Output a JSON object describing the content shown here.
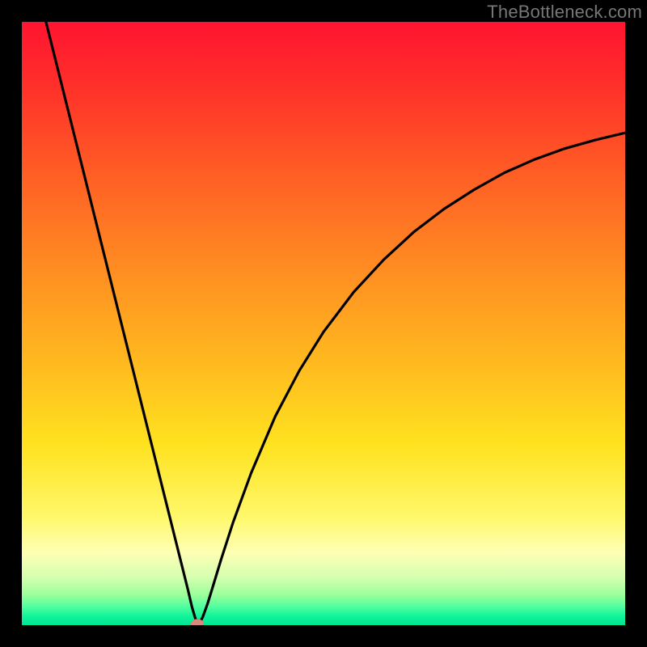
{
  "watermark": "TheBottleneck.com",
  "colors": {
    "page_bg": "#000000",
    "gradient_top": "#ff1430",
    "gradient_mid": "#ffe21f",
    "gradient_bottom": "#00e493",
    "curve": "#000000",
    "marker": "#d88a7a"
  },
  "chart_data": {
    "type": "line",
    "title": "",
    "xlabel": "",
    "ylabel": "",
    "xlim": [
      0,
      100
    ],
    "ylim": [
      0,
      100
    ],
    "grid": false,
    "annotations": [],
    "series": [
      {
        "name": "curve",
        "x": [
          4,
          6,
          8,
          10,
          12,
          14,
          16,
          18,
          20,
          22,
          24,
          26,
          27.5,
          28.2,
          28.7,
          29,
          29.1,
          29.3,
          29.5,
          30,
          30.8,
          31.6,
          33,
          35,
          38,
          42,
          46,
          50,
          55,
          60,
          65,
          70,
          75,
          80,
          85,
          90,
          95,
          100
        ],
        "y": [
          100,
          92,
          84,
          76,
          68,
          60,
          52,
          44,
          36,
          28,
          20,
          12,
          6,
          3,
          1.3,
          0.5,
          0.2,
          0.2,
          0.4,
          1.4,
          3.6,
          6.2,
          10.8,
          17.0,
          25.2,
          34.6,
          42.2,
          48.6,
          55.2,
          60.6,
          65.2,
          69.0,
          72.2,
          75.0,
          77.2,
          79.0,
          80.4,
          81.6
        ]
      }
    ],
    "marker": {
      "x": 29.1,
      "y": 0.2
    }
  }
}
